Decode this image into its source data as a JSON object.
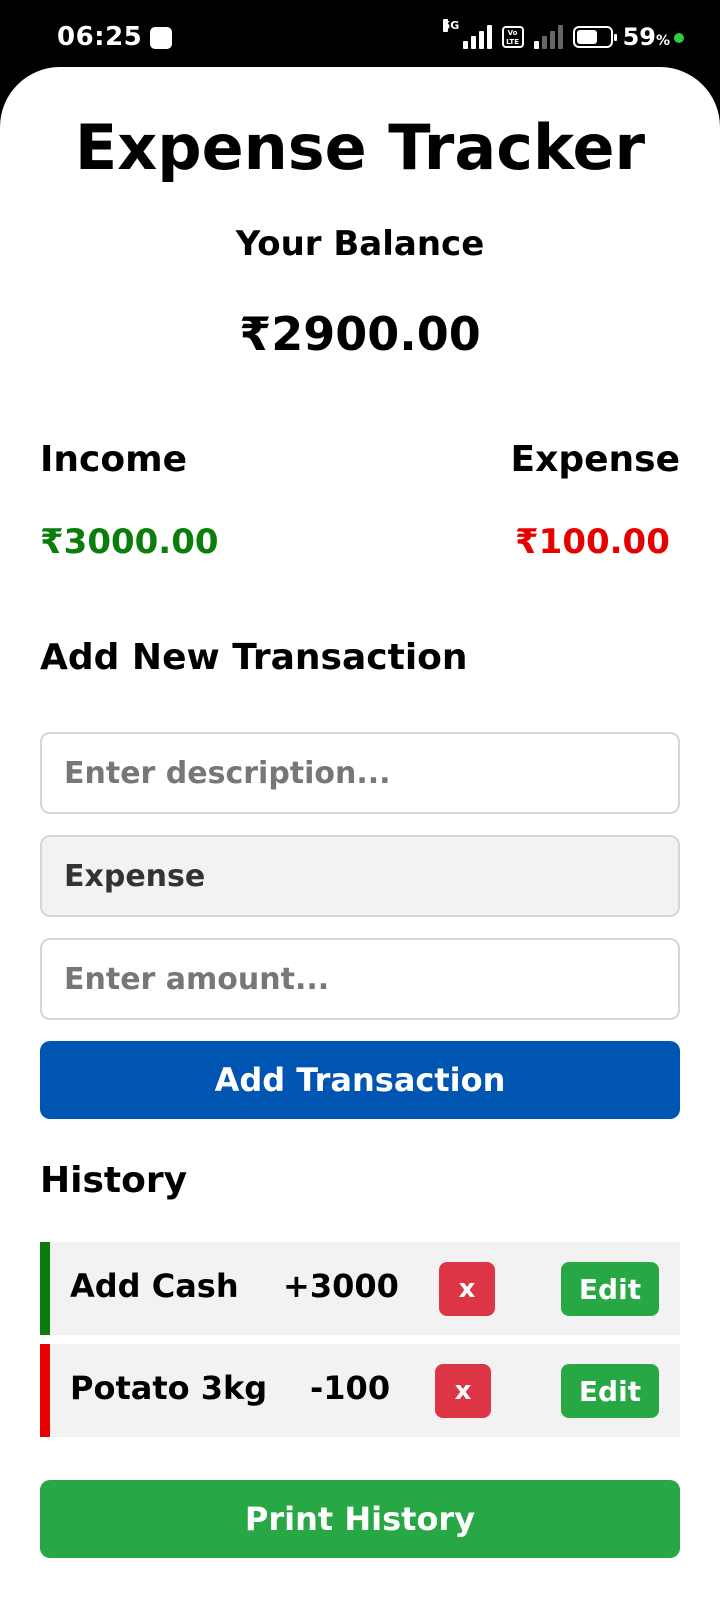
{
  "status_bar": {
    "time": "06:25",
    "network": "5G",
    "volte": "Vo LTE",
    "battery": "59",
    "battery_unit": "%"
  },
  "app": {
    "title": "Expense Tracker",
    "balance_label": "Your Balance",
    "balance_value": "₹2900.00",
    "income_label": "Income",
    "income_value": "₹3000.00",
    "expense_label": "Expense",
    "expense_value": "₹100.00",
    "income_color": "#0a7d0a",
    "expense_color": "#e60000"
  },
  "form": {
    "heading": "Add New Transaction",
    "description_placeholder": "Enter description...",
    "description_value": "",
    "type_selected": "Expense",
    "amount_placeholder": "Enter amount...",
    "amount_value": "",
    "submit_label": "Add Transaction"
  },
  "history": {
    "heading": "History",
    "delete_label": "x",
    "edit_label": "Edit",
    "items": [
      {
        "description": "Add Cash",
        "amount": "+3000",
        "type": "income",
        "color": "#0a7d0a"
      },
      {
        "description": "Potato 3kg",
        "amount": "-100",
        "type": "expense",
        "color": "#e60000"
      }
    ],
    "print_label": "Print History"
  }
}
